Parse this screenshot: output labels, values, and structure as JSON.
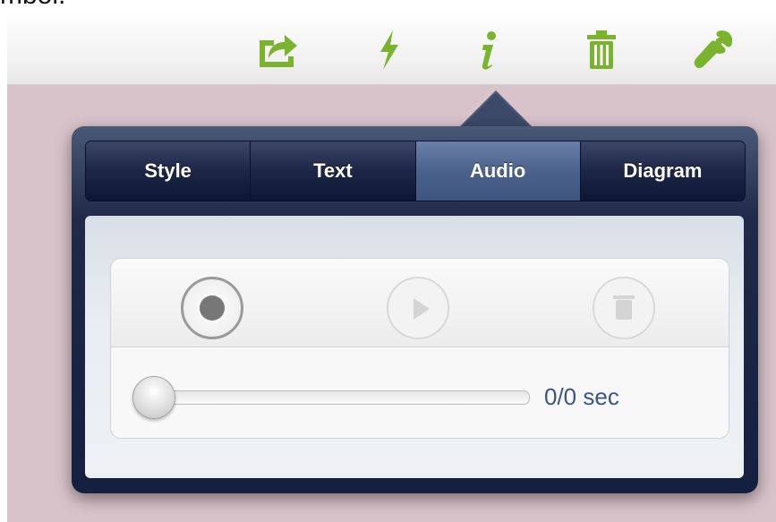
{
  "caption": "mbol.",
  "toolbar": {
    "icons": [
      "share-icon",
      "lightning-icon",
      "info-icon",
      "trash-icon",
      "wrench-icon"
    ],
    "accent_color": "#7ab32e"
  },
  "popover": {
    "tabs": [
      {
        "label": "Style",
        "active": false
      },
      {
        "label": "Text",
        "active": false
      },
      {
        "label": "Audio",
        "active": true
      },
      {
        "label": "Diagram",
        "active": false
      }
    ],
    "audio": {
      "controls": [
        "record-icon",
        "play-icon",
        "delete-icon"
      ],
      "slider_value": 0,
      "time_label": "0/0 sec"
    }
  }
}
